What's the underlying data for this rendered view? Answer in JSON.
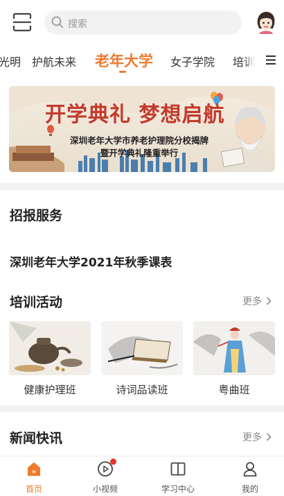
{
  "search": {
    "placeholder": "搜索"
  },
  "tabs": [
    {
      "label": "光明"
    },
    {
      "label": "护航未来"
    },
    {
      "label": "老年大学",
      "active": true
    },
    {
      "label": "女子学院"
    },
    {
      "label": "培训"
    }
  ],
  "banner": {
    "title": "开学典礼 梦想启航",
    "subtitle_line1": "深圳老年大学市养老护理院分校揭牌",
    "subtitle_line2": "暨开学典礼隆重举行"
  },
  "sections": {
    "admissions": {
      "title": "招报服务",
      "course_link": "深圳老年大学2021年秋季课表"
    },
    "training": {
      "title": "培训活动",
      "more": "更多",
      "cards": [
        {
          "label": "健康护理班"
        },
        {
          "label": "诗词品读班"
        },
        {
          "label": "粤曲班"
        }
      ]
    },
    "news": {
      "title": "新闻快讯",
      "more": "更多"
    }
  },
  "bottom_nav": [
    {
      "label": "首页",
      "icon": "home-icon",
      "active": true
    },
    {
      "label": "小视频",
      "icon": "video-icon",
      "badge": true
    },
    {
      "label": "学习中心",
      "icon": "book-icon"
    },
    {
      "label": "我的",
      "icon": "profile-icon"
    }
  ],
  "colors": {
    "accent": "#ef7a2e",
    "badge": "#e8332a",
    "divider": "#f2f2f2"
  }
}
